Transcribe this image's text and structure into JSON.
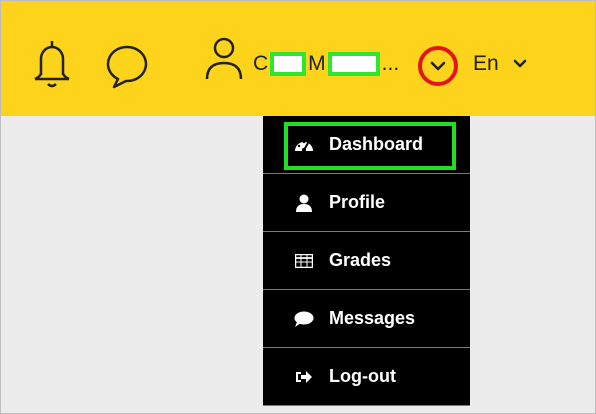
{
  "header": {
    "notifications_icon": "bell-icon",
    "messages_icon": "chat-bubble-icon",
    "profile_icon": "user-icon",
    "user_name": {
      "first_initial": "C",
      "last_initial": "M",
      "ellipsis": "..."
    },
    "user_menu_toggle_icon": "chevron-down-icon",
    "language": {
      "label": "En",
      "icon": "chevron-down-icon"
    },
    "background_color": "#fdd31b"
  },
  "user_menu": {
    "items": [
      {
        "label": "Dashboard",
        "icon": "dashboard-gauge-icon"
      },
      {
        "label": "Profile",
        "icon": "user-icon"
      },
      {
        "label": "Grades",
        "icon": "table-grid-icon"
      },
      {
        "label": "Messages",
        "icon": "comment-icon"
      },
      {
        "label": "Log-out",
        "icon": "sign-out-icon"
      }
    ]
  },
  "annotations": {
    "highlight_color": "#22dd22",
    "circle_color": "#e21616"
  }
}
